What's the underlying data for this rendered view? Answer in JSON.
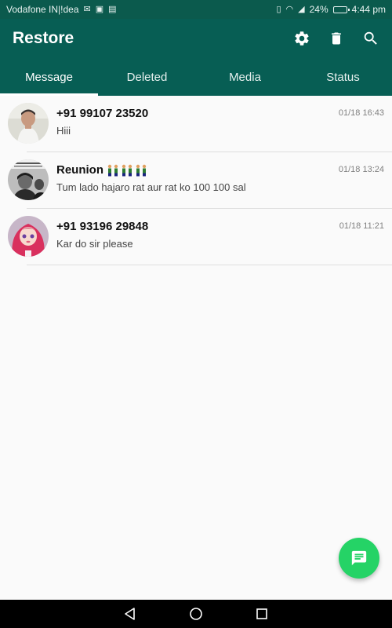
{
  "status_bar": {
    "carrier": "Vodafone IN|!dea",
    "battery_percent": "24%",
    "battery_level": 0.24,
    "time": "4:44 pm"
  },
  "app_bar": {
    "title": "Restore",
    "icons": [
      "gear-icon",
      "trash-icon",
      "search-icon"
    ]
  },
  "tabs": [
    {
      "label": "Message",
      "active": true
    },
    {
      "label": "Deleted",
      "active": false
    },
    {
      "label": "Media",
      "active": false
    },
    {
      "label": "Status",
      "active": false
    }
  ],
  "conversations": [
    {
      "name": "+91 99107 23520",
      "message": "Hiii",
      "time": "01/18 16:43"
    },
    {
      "name": "Reunion",
      "message": "Tum lado hajaro rat aur rat ko 100 100 sal",
      "time": "01/18 13:24"
    },
    {
      "name": "+91 93196 29848",
      "message": "Kar do sir please",
      "time": "01/18 11:21"
    }
  ],
  "colors": {
    "primary": "#075e54",
    "status_bar": "#0b5a4d",
    "fab": "#25d366"
  }
}
